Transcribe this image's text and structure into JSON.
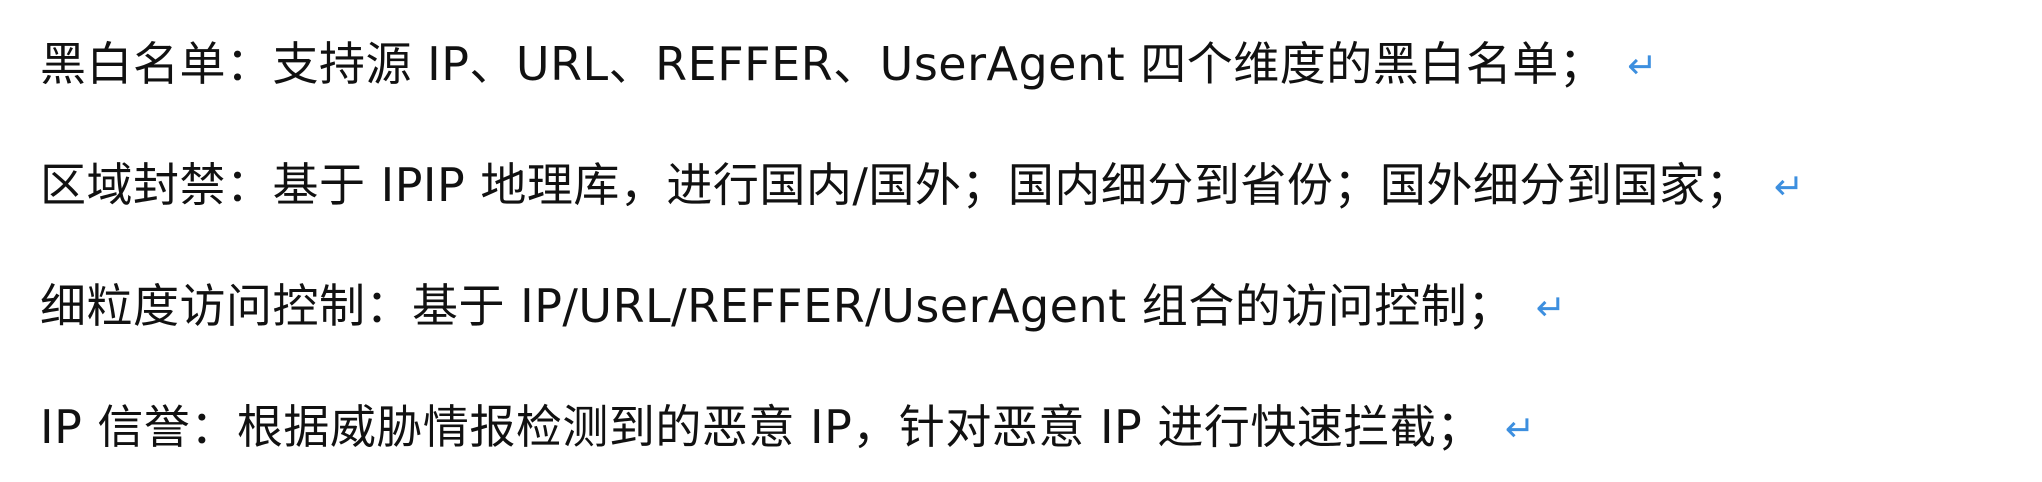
{
  "document": {
    "paragraph_mark": "↵",
    "lines": [
      "黑白名单：支持源 IP、URL、REFFER、UserAgent 四个维度的黑白名单；",
      "区域封禁：基于 IPIP 地理库，进行国内/国外；国内细分到省份；国外细分到国家；",
      "细粒度访问控制：基于 IP/URL/REFFER/UserAgent 组合的访问控制；",
      "IP 信誉：根据威胁情报检测到的恶意 IP，针对恶意 IP 进行快速拦截；"
    ]
  },
  "colors": {
    "text": "#111111",
    "paragraph_mark": "#3d8fdf",
    "background": "#ffffff"
  }
}
